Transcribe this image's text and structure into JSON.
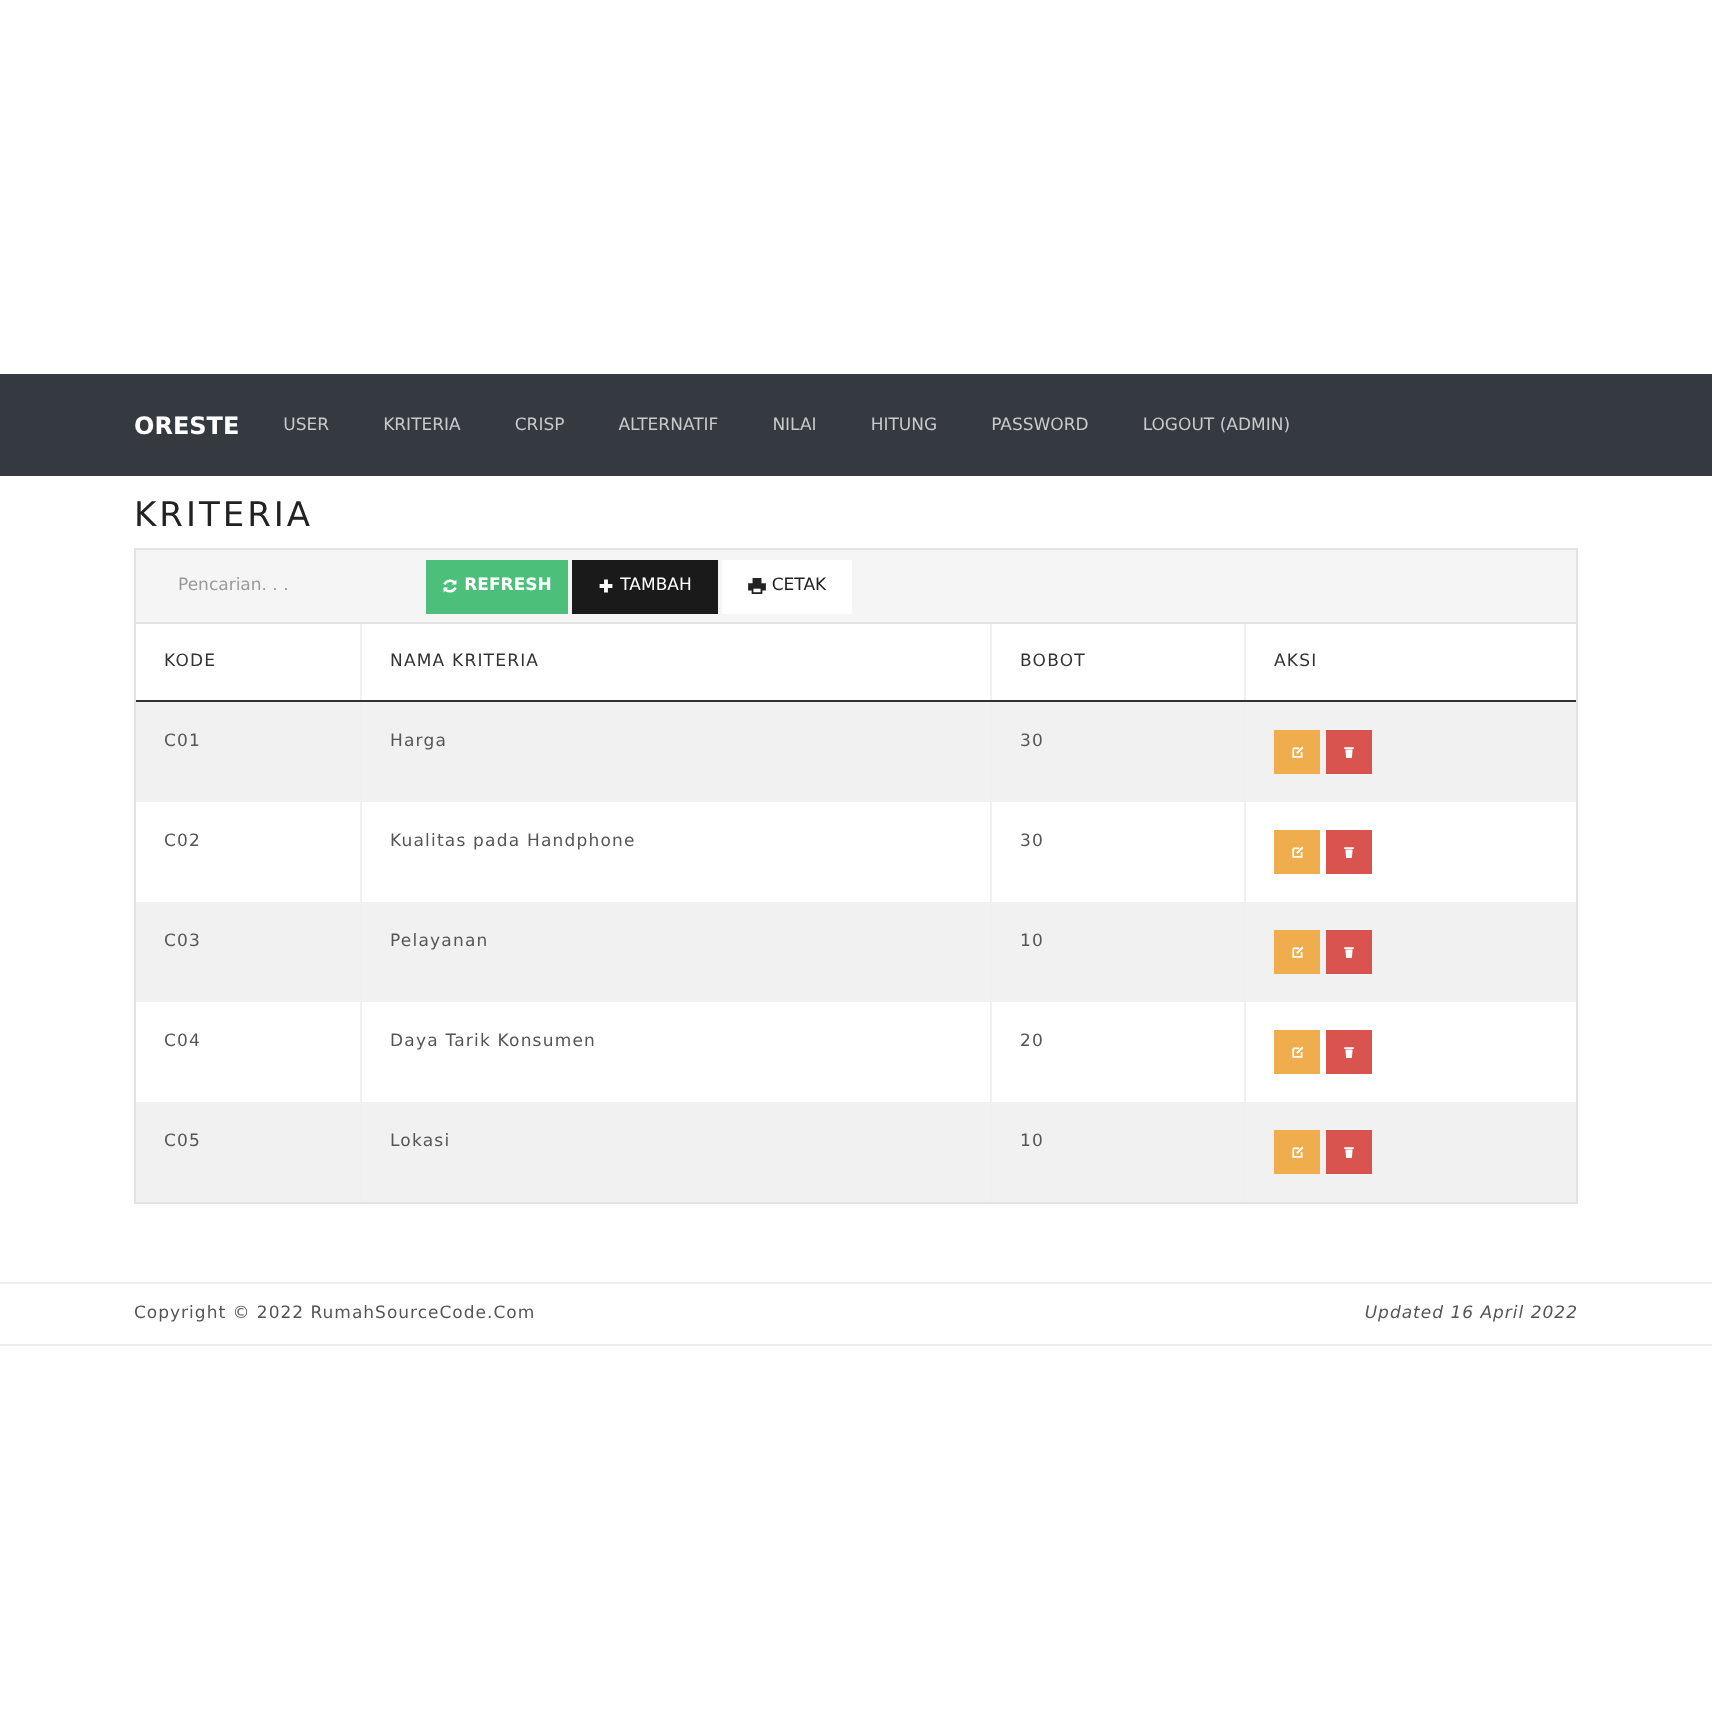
{
  "navbar": {
    "brand": "ORESTE",
    "items": [
      {
        "label": "USER"
      },
      {
        "label": "KRITERIA"
      },
      {
        "label": "CRISP"
      },
      {
        "label": "ALTERNATIF"
      },
      {
        "label": "NILAI"
      },
      {
        "label": "HITUNG"
      },
      {
        "label": "PASSWORD"
      },
      {
        "label": "LOGOUT (ADMIN)"
      }
    ]
  },
  "page_title": "KRITERIA",
  "toolbar": {
    "search": {
      "placeholder": "Pencarian. . ."
    },
    "buttons": [
      {
        "label": "REFRESH",
        "kind": "refresh"
      },
      {
        "label": "TAMBAH",
        "kind": "add"
      },
      {
        "label": "CETAK",
        "kind": "print"
      }
    ]
  },
  "table": {
    "columns": [
      "KODE",
      "NAMA KRITERIA",
      "BOBOT",
      "AKSI"
    ],
    "rows": [
      {
        "kode": "C01",
        "nama": "Harga",
        "bobot": "30"
      },
      {
        "kode": "C02",
        "nama": "Kualitas pada Handphone",
        "bobot": "30"
      },
      {
        "kode": "C03",
        "nama": "Pelayanan",
        "bobot": "10"
      },
      {
        "kode": "C04",
        "nama": "Daya Tarik Konsumen",
        "bobot": "20"
      },
      {
        "kode": "C05",
        "nama": "Lokasi",
        "bobot": "10"
      }
    ]
  },
  "footer": {
    "copyright": "Copyright © 2022 RumahSourceCode.Com",
    "updated": "Updated 16 April 2022"
  }
}
